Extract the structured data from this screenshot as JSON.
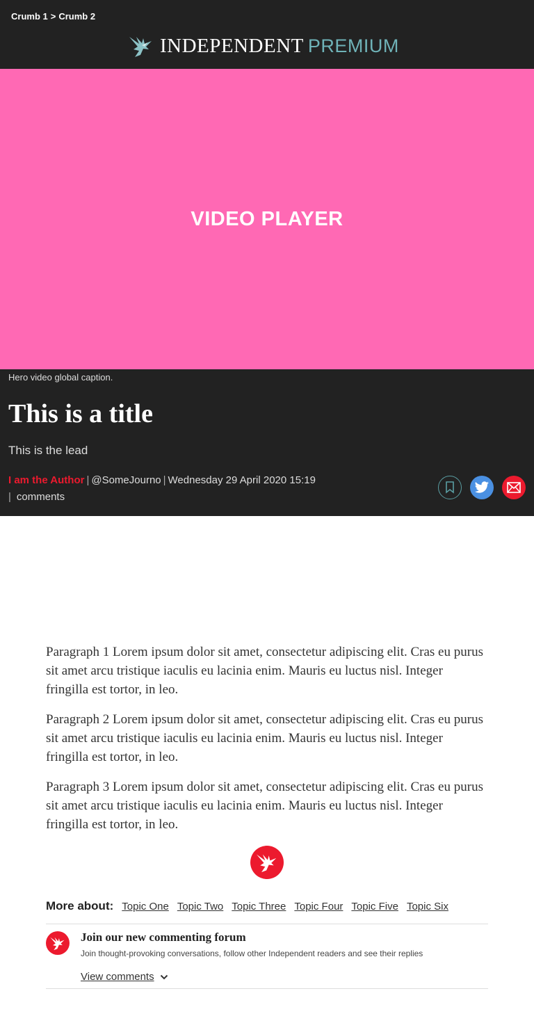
{
  "breadcrumb": {
    "crumb1": "Crumb 1",
    "separator": ">",
    "crumb2": "Crumb 2"
  },
  "brand": {
    "name": "INDEPENDENT",
    "premium": "PREMIUM",
    "icon": "eagle-icon"
  },
  "video": {
    "label": "VIDEO PLAYER",
    "background": "#ff69b4"
  },
  "hero": {
    "caption": "Hero video global caption.",
    "title": "This is a title",
    "lead": "This is the lead",
    "author": "I am the Author",
    "handle": "@SomeJourno",
    "date": "Wednesday 29 April 2020 15:19",
    "comments_label": "comments"
  },
  "share": {
    "bookmark_icon": "bookmark-icon",
    "twitter_icon": "twitter-icon",
    "email_icon": "email-icon"
  },
  "article": {
    "paragraphs": [
      "Paragraph 1 Lorem ipsum dolor sit amet, consectetur adipiscing elit. Cras eu purus sit amet arcu tristique iaculis eu lacinia enim. Mauris eu luctus nisl. Integer fringilla est tortor, in leo.",
      "Paragraph 2 Lorem ipsum dolor sit amet, consectetur adipiscing elit. Cras eu purus sit amet arcu tristique iaculis eu lacinia enim. Mauris eu luctus nisl. Integer fringilla est tortor, in leo.",
      "Paragraph 3 Lorem ipsum dolor sit amet, consectetur adipiscing elit. Cras eu purus sit amet arcu tristique iaculis eu lacinia enim. Mauris eu luctus nisl. Integer fringilla est tortor, in leo."
    ]
  },
  "topics": {
    "label": "More about:",
    "items": [
      "Topic One",
      "Topic Two",
      "Topic Three",
      "Topic Four",
      "Topic Five",
      "Topic Six"
    ]
  },
  "forum": {
    "title": "Join our new commenting forum",
    "description": "Join thought-provoking conversations, follow other Independent readers and see their replies",
    "view_label": "View comments"
  },
  "colors": {
    "header_bg": "#222222",
    "accent_red": "#ec1a2e",
    "premium_teal": "#6fb3b8",
    "twitter_blue": "#4a90e2"
  }
}
